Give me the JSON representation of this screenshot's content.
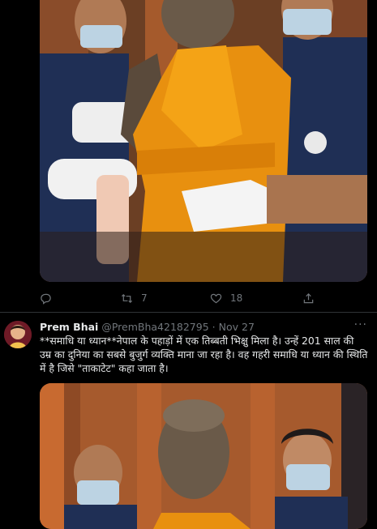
{
  "first_tweet": {
    "actions": {
      "reply_count": "",
      "retweet_count": "7",
      "like_count": "18"
    }
  },
  "second_tweet": {
    "display_name": "Prem Bhai",
    "handle": "@PremBha42182795",
    "separator": "·",
    "date": "Nov 27",
    "more_label": "···",
    "text": "**समाधि या ध्यान**नेपाल के पहाड़ों में एक तिब्बती भिक्षु मिला है। उन्हें 201 साल की उम्र का दुनिया का सबसे बुजुर्ग व्यक्ति माना जा रहा है। वह गहरी समाधि या ध्यान की स्थिति में है जिसे \"ताकाटेट\" कहा जाता है।"
  },
  "colors": {
    "background": "#000000",
    "text_primary": "#e7e9ea",
    "text_secondary": "#71767b",
    "divider": "#2f3336",
    "robe": "#e8900f",
    "uniform": "#1f2f55"
  },
  "icons": [
    "reply-icon",
    "retweet-icon",
    "like-icon",
    "share-icon",
    "more-icon"
  ]
}
